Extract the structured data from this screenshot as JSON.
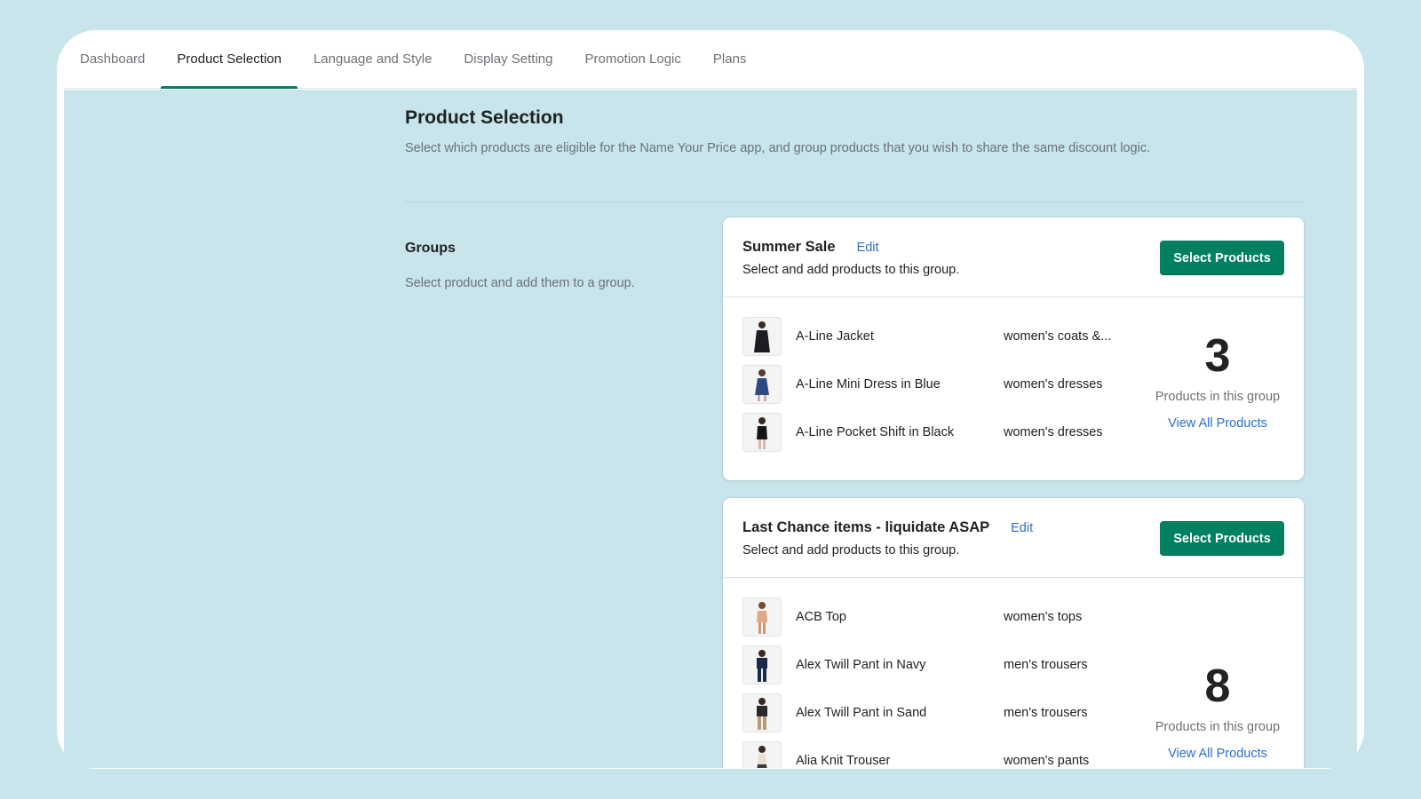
{
  "tabs": [
    {
      "label": "Dashboard"
    },
    {
      "label": "Product Selection"
    },
    {
      "label": "Language and Style"
    },
    {
      "label": "Display Setting"
    },
    {
      "label": "Promotion Logic"
    },
    {
      "label": "Plans"
    }
  ],
  "active_tab": "Product Selection",
  "page": {
    "title": "Product Selection",
    "description": "Select which products are eligible for the Name Your Price app, and group products that you wish to share the same discount logic."
  },
  "groups": {
    "title": "Groups",
    "description": "Select product and add them to a group."
  },
  "cards": [
    {
      "title": "Summer Sale",
      "edit_label": "Edit",
      "subtitle": "Select and add products to this group.",
      "button_label": "Select Products",
      "products": [
        {
          "name": "A-Line Jacket",
          "type": "women's coats &..."
        },
        {
          "name": "A-Line Mini Dress in Blue",
          "type": "women's dresses"
        },
        {
          "name": "A-Line Pocket Shift in Black",
          "type": "women's dresses"
        }
      ],
      "count": "3",
      "count_label": "Products in this group",
      "view_all_label": "View All Products"
    },
    {
      "title": "Last Chance items - liquidate ASAP",
      "edit_label": "Edit",
      "subtitle": "Select and add products to this group.",
      "button_label": "Select Products",
      "products": [
        {
          "name": "ACB Top",
          "type": "women's tops"
        },
        {
          "name": "Alex Twill Pant in Navy",
          "type": "men's trousers"
        },
        {
          "name": "Alex Twill Pant in Sand",
          "type": "men's trousers"
        },
        {
          "name": "Alia Knit Trouser",
          "type": "women's pants"
        }
      ],
      "count": "8",
      "count_label": "Products in this group",
      "view_all_label": "View All Products"
    }
  ],
  "colors": {
    "background": "#c7e5ea",
    "primary": "#008060",
    "link": "#2c6ecb"
  }
}
